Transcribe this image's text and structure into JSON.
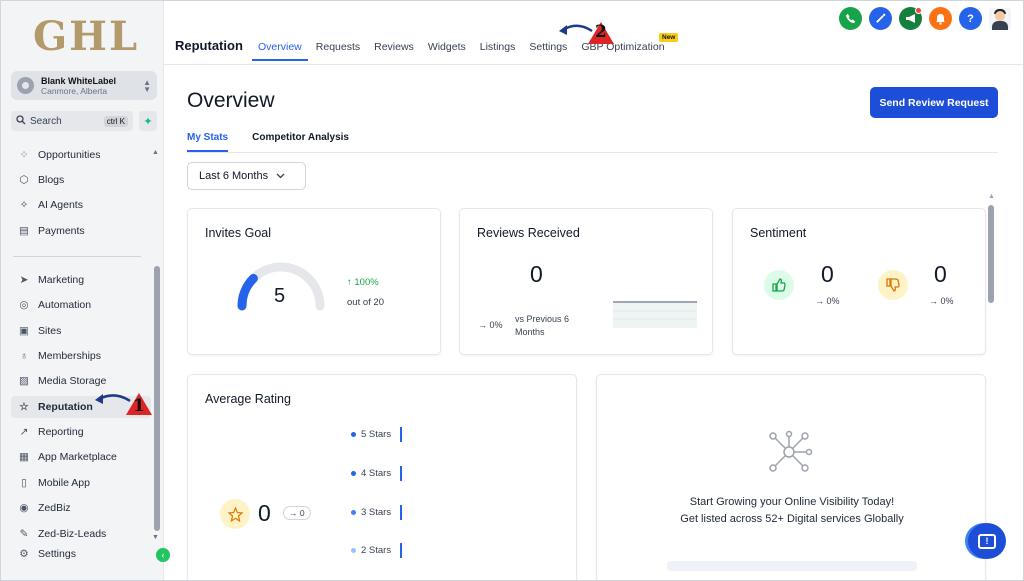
{
  "app": {
    "logo": "GHL"
  },
  "account": {
    "name": "Blank WhiteLabel",
    "location": "Canmore, Alberta"
  },
  "search": {
    "label": "Search",
    "shortcut": "ctrl K"
  },
  "sidebar": {
    "items": [
      {
        "label": "Opportunities",
        "icon": "opportunities-icon"
      },
      {
        "label": "Blogs",
        "icon": "cube-icon"
      },
      {
        "label": "AI Agents",
        "icon": "sparkles-icon"
      },
      {
        "label": "Payments",
        "icon": "receipt-icon"
      },
      {
        "label": "Marketing",
        "icon": "send-icon"
      },
      {
        "label": "Automation",
        "icon": "automation-icon"
      },
      {
        "label": "Sites",
        "icon": "globe-window-icon"
      },
      {
        "label": "Memberships",
        "icon": "award-icon"
      },
      {
        "label": "Media Storage",
        "icon": "image-icon"
      },
      {
        "label": "Reputation",
        "icon": "star-icon",
        "active": true
      },
      {
        "label": "Reporting",
        "icon": "trend-icon"
      },
      {
        "label": "App Marketplace",
        "icon": "grid-icon"
      },
      {
        "label": "Mobile App",
        "icon": "phone-icon"
      },
      {
        "label": "ZedBiz",
        "icon": "zedbiz-icon"
      },
      {
        "label": "Zed-Biz-Leads",
        "icon": "wrench-icon"
      },
      {
        "label": "Settings",
        "icon": "gear-icon"
      }
    ]
  },
  "topbar": {
    "title": "Reputation",
    "tabs": [
      "Overview",
      "Requests",
      "Reviews",
      "Widgets",
      "Listings",
      "Settings",
      "GBP Optimization"
    ],
    "active_tab": "Overview",
    "new_badge": "New",
    "icon_colors": {
      "phone": "#16a34a",
      "magic": "#2563eb",
      "megaphone": "#15803d",
      "bell": "#f97316",
      "help": "#2563eb"
    }
  },
  "annotations": {
    "one": "1",
    "two": "2"
  },
  "main": {
    "title": "Overview",
    "cta": "Send Review Request",
    "subtabs": [
      "My Stats",
      "Competitor Analysis"
    ],
    "range": "Last 6 Months"
  },
  "cards": {
    "invites": {
      "title": "Invites Goal",
      "value": "5",
      "growth": "100%",
      "out_of": "out of 20",
      "gauge_fraction": 0.25
    },
    "reviews": {
      "title": "Reviews Received",
      "value": "0",
      "delta": "→ 0%",
      "compare_line1": "vs Previous 6",
      "compare_line2": "Months"
    },
    "sentiment": {
      "title": "Sentiment",
      "positive": "0",
      "positive_delta": "→ 0%",
      "negative": "0",
      "negative_delta": "→ 0%"
    },
    "rating": {
      "title": "Average Rating",
      "value": "0",
      "delta": "→ 0",
      "rows": [
        {
          "label": "5 Stars"
        },
        {
          "label": "4 Stars"
        },
        {
          "label": "3 Stars"
        },
        {
          "label": "2 Stars"
        }
      ]
    },
    "listings": {
      "line1": "Start Growing your Online Visibility Today!",
      "line2": "Get listed across 52+ Digital services Globally"
    }
  }
}
